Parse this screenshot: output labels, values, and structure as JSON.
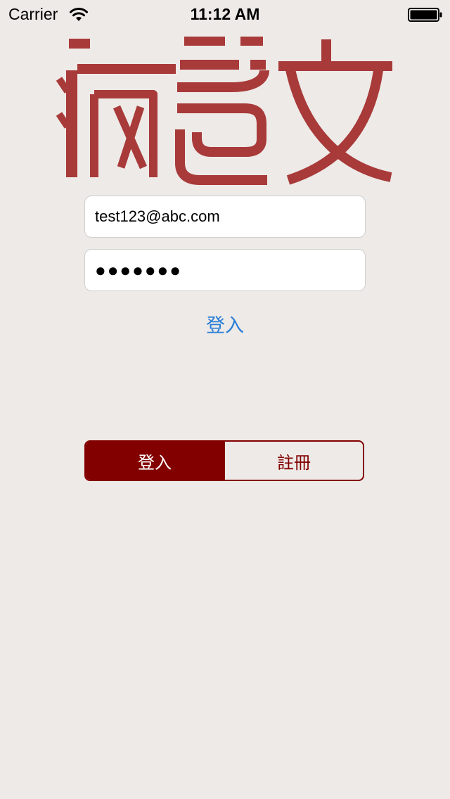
{
  "status_bar": {
    "carrier": "Carrier",
    "time": "11:12 AM"
  },
  "logo": {
    "text": "瘋笆文",
    "color": "#a83a3a"
  },
  "login_form": {
    "email_value": "test123@abc.com",
    "password_masked": "●●●●●●●",
    "login_button_label": "登入",
    "link_color": "#2a7ed8"
  },
  "mode_switch": {
    "segments": [
      {
        "label": "登入",
        "selected": true
      },
      {
        "label": "註冊",
        "selected": false
      }
    ],
    "accent_color": "#820000"
  }
}
